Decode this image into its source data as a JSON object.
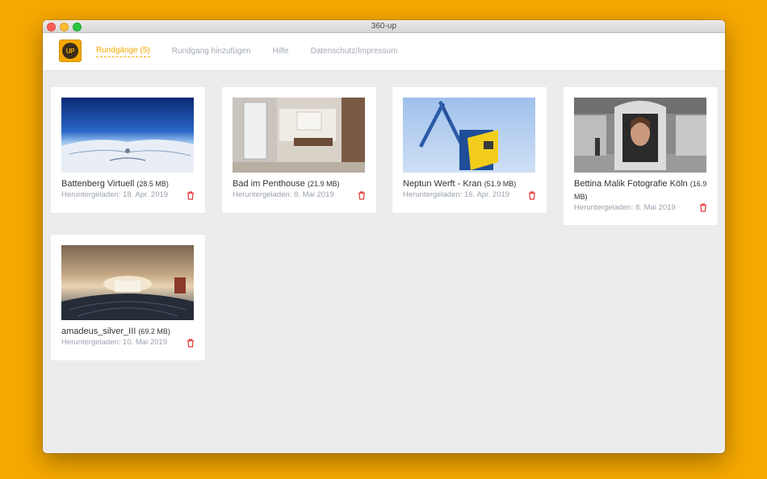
{
  "window": {
    "title": "360-up"
  },
  "header": {
    "logo_text": "UP",
    "nav": [
      {
        "label": "Rundgänge (5)",
        "active": true
      },
      {
        "label": "Rundgang hinzufügen"
      },
      {
        "label": "Hilfe"
      },
      {
        "label": "Datenschutz/Impressum"
      }
    ]
  },
  "tours": [
    {
      "title": "Battenberg Virtuell",
      "size": "(28.5 MB)",
      "date": "Heruntergeladen: 18. Apr. 2019",
      "thumb": "snow-panorama"
    },
    {
      "title": "Bad im Penthouse",
      "size": "(21.9 MB)",
      "date": "Heruntergeladen: 8. Mai 2019",
      "thumb": "bathroom"
    },
    {
      "title": "Neptun Werft - Kran",
      "size": "(51.9 MB)",
      "date": "Heruntergeladen: 16. Apr. 2019",
      "thumb": "crane"
    },
    {
      "title": "Bettina Malik Fotografie Köln",
      "size": "(16.9 MB)",
      "date": "Heruntergeladen: 8. Mai 2019",
      "thumb": "photo-studio"
    },
    {
      "title": "amadeus_silver_III",
      "size": "(69.2 MB)",
      "date": "Heruntergeladen: 10. Mai 2019",
      "thumb": "ship-interior"
    }
  ],
  "colors": {
    "accent": "#f5a800",
    "delete": "#e53935"
  },
  "icons": {
    "delete": "trash-icon"
  }
}
